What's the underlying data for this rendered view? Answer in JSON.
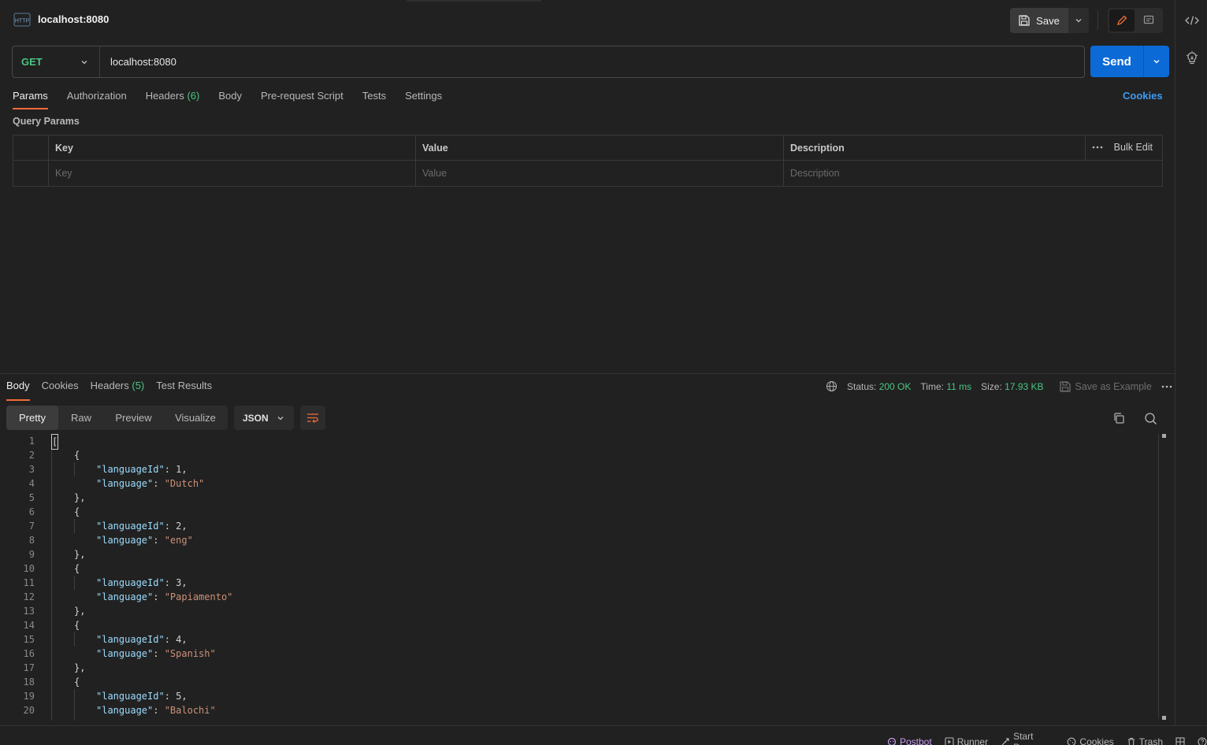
{
  "tab": {
    "title": "localhost:8080",
    "badge": "HTTP"
  },
  "toolbar": {
    "save_label": "Save"
  },
  "request": {
    "method": "GET",
    "url": "localhost:8080",
    "send_label": "Send"
  },
  "req_tabs": {
    "params": "Params",
    "authorization": "Authorization",
    "headers": "Headers",
    "headers_count": "(6)",
    "body": "Body",
    "prerequest": "Pre-request Script",
    "tests": "Tests",
    "settings": "Settings",
    "cookies": "Cookies"
  },
  "query_params": {
    "title": "Query Params",
    "col_key": "Key",
    "col_value": "Value",
    "col_description": "Description",
    "bulk_edit": "Bulk Edit",
    "ph_key": "Key",
    "ph_value": "Value",
    "ph_description": "Description"
  },
  "response": {
    "tabs": {
      "body": "Body",
      "cookies": "Cookies",
      "headers": "Headers",
      "headers_count": "(5)",
      "test_results": "Test Results"
    },
    "status_label": "Status:",
    "status_value": "200 OK",
    "time_label": "Time:",
    "time_value": "11 ms",
    "size_label": "Size:",
    "size_value": "17.93 KB",
    "save_example": "Save as Example",
    "views": {
      "pretty": "Pretty",
      "raw": "Raw",
      "preview": "Preview",
      "visualize": "Visualize"
    },
    "format": "JSON"
  },
  "code_lines": [
    [
      "1",
      "["
    ],
    [
      "2",
      "{"
    ],
    [
      "3",
      "\"languageId\"",
      ": ",
      "1",
      ","
    ],
    [
      "4",
      "\"language\"",
      ": ",
      "\"Dutch\"",
      ""
    ],
    [
      "5",
      "},"
    ],
    [
      "6",
      "{"
    ],
    [
      "7",
      "\"languageId\"",
      ": ",
      "2",
      ","
    ],
    [
      "8",
      "\"language\"",
      ": ",
      "\"eng\"",
      ""
    ],
    [
      "9",
      "},"
    ],
    [
      "10",
      "{"
    ],
    [
      "11",
      "\"languageId\"",
      ": ",
      "3",
      ","
    ],
    [
      "12",
      "\"language\"",
      ": ",
      "\"Papiamento\"",
      ""
    ],
    [
      "13",
      "},"
    ],
    [
      "14",
      "{"
    ],
    [
      "15",
      "\"languageId\"",
      ": ",
      "4",
      ","
    ],
    [
      "16",
      "\"language\"",
      ": ",
      "\"Spanish\"",
      ""
    ],
    [
      "17",
      "},"
    ],
    [
      "18",
      "{"
    ],
    [
      "19",
      "\"languageId\"",
      ": ",
      "5",
      ","
    ],
    [
      "20",
      "\"language\"",
      ": ",
      "\"Balochi\"",
      ""
    ]
  ],
  "statusbar": {
    "postbot": "Postbot",
    "runner": "Runner",
    "start_proxy": "Start Proxy",
    "cookies": "Cookies",
    "trash": "Trash"
  },
  "colors": {
    "accent": "#f26b3a",
    "send": "#0c6ad6",
    "method_get": "#4bc482",
    "link": "#3d9cf5"
  },
  "icons": [
    "http-icon",
    "save-icon",
    "chevron-down-icon",
    "edit-icon",
    "comment-icon",
    "code-icon",
    "lightbulb-icon",
    "globe-icon",
    "more-icon",
    "wrap-icon",
    "copy-icon",
    "search-icon",
    "postbot-icon",
    "runner-icon",
    "proxy-icon",
    "cookie-icon",
    "trash-icon",
    "layout-icon",
    "help-icon"
  ]
}
